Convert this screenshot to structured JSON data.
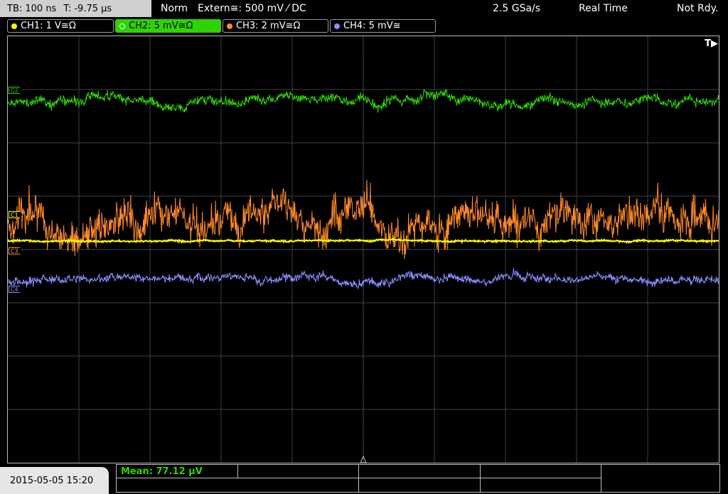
{
  "top": {
    "timebase": "TB: 100 ns",
    "trigger_time": "T: -9.75 µs",
    "mode": "Norm",
    "trigger_source": "Extern≅: 500 mV ⁄ DC",
    "sample_rate": "2.5 GSa/s",
    "acq_mode": "Real Time",
    "status": "Not Rdy."
  },
  "channels": [
    {
      "label": "CH1: 1 V≅Ω",
      "color": "#ffff00",
      "marker": "C1"
    },
    {
      "label": "CH2: 5 mV≅Ω",
      "color": "#2ed400",
      "marker": "C2"
    },
    {
      "label": "CH3: 2 mV≅Ω",
      "color": "#ff8a2a",
      "marker": "C3"
    },
    {
      "label": "CH4: 5 mV≅",
      "color": "#8a8cff",
      "marker": "C4"
    }
  ],
  "trigger_indicator": "T▶",
  "footer": {
    "datetime": "2015-05-05 15:20",
    "mean": "Mean: 77.12 µV"
  },
  "colors": {
    "background": "#000000",
    "grid": "#404040",
    "frame": "#bdbdbd",
    "active_tab": "#2ed400"
  },
  "chart_data": {
    "type": "line",
    "grid": true,
    "divisions": {
      "x": 10,
      "y": 8
    },
    "series": [
      {
        "name": "CH2",
        "color": "#2ed400",
        "level_div": 2.78,
        "noise_div": 0.12
      },
      {
        "name": "CH1",
        "color": "#ffff00",
        "level_div": 0.16,
        "noise_div": 0.02
      },
      {
        "name": "CH3",
        "color": "#ff8a2a",
        "level_div": 0.43,
        "noise_div": 0.45
      },
      {
        "name": "CH4",
        "color": "#8a8cff",
        "level_div": -0.57,
        "noise_div": 0.1
      }
    ]
  }
}
